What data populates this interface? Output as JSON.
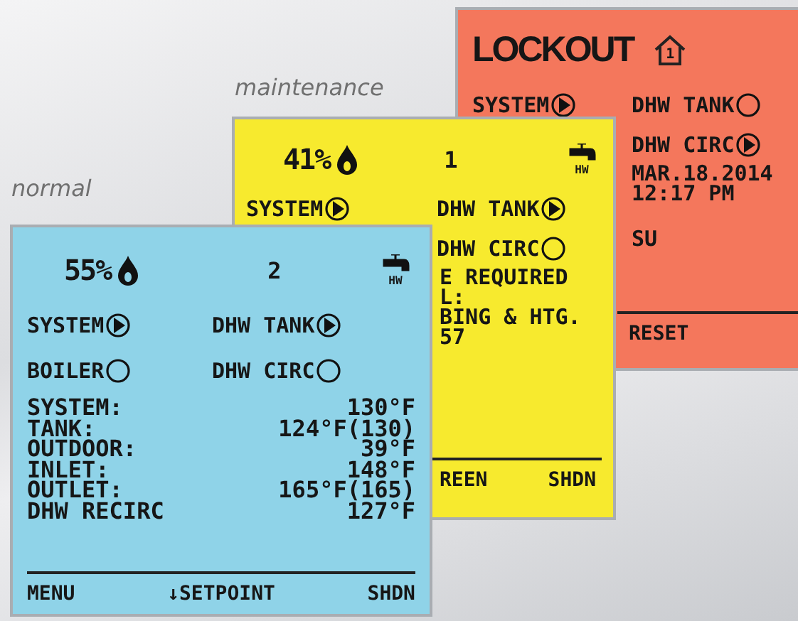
{
  "screens": [
    {
      "kind": "lockout",
      "color": "#f4775c",
      "header": {
        "title": "LOCKOUT",
        "zone": "1"
      },
      "pump_rows": [
        {
          "left": {
            "label": "SYSTEM",
            "on": true
          },
          "right": {
            "label": "DHW TANK",
            "on": false
          }
        },
        {
          "right": {
            "label": "DHW CIRC",
            "on": true
          }
        }
      ],
      "lines": [
        "MAR.18.2014",
        "12:17 PM",
        "SU"
      ],
      "footer": [
        "RESET"
      ]
    },
    {
      "kind": "maintenance",
      "caption": "maintenance",
      "color": "#f7ea2e",
      "header": {
        "percent": "41%",
        "zone": "1",
        "tap_label": "HW"
      },
      "pump_rows": [
        {
          "left": {
            "label": "SYSTEM",
            "on": true
          },
          "right": {
            "label": "DHW TANK",
            "on": true
          }
        },
        {
          "right": {
            "label": "DHW CIRC",
            "on": false
          }
        }
      ],
      "lines": [
        "E REQUIRED",
        "L:",
        "BING & HTG.",
        "57"
      ],
      "footer": [
        "REEN",
        "SHDN"
      ]
    },
    {
      "kind": "normal",
      "caption": "normal",
      "color": "#8fd3e8",
      "header": {
        "percent": "55%",
        "zone": "2",
        "tap_label": "HW"
      },
      "pump_rows": [
        {
          "left": {
            "label": "SYSTEM",
            "on": true
          },
          "right": {
            "label": "DHW TANK",
            "on": true
          }
        },
        {
          "left": {
            "label": "BOILER",
            "on": false
          },
          "right": {
            "label": "DHW CIRC",
            "on": false
          }
        }
      ],
      "readings": [
        {
          "label": "SYSTEM:",
          "value": "130°F"
        },
        {
          "label": "TANK:",
          "value": "124°F(130)"
        },
        {
          "label": "OUTDOOR:",
          "value": "39°F"
        },
        {
          "label": "INLET:",
          "value": "148°F"
        },
        {
          "label": "OUTLET:",
          "value": "165°F(165)"
        },
        {
          "label": "DHW RECIRC",
          "value": "127°F"
        }
      ],
      "footer": [
        "MENU",
        "↓SETPOINT",
        "SHDN"
      ]
    }
  ]
}
